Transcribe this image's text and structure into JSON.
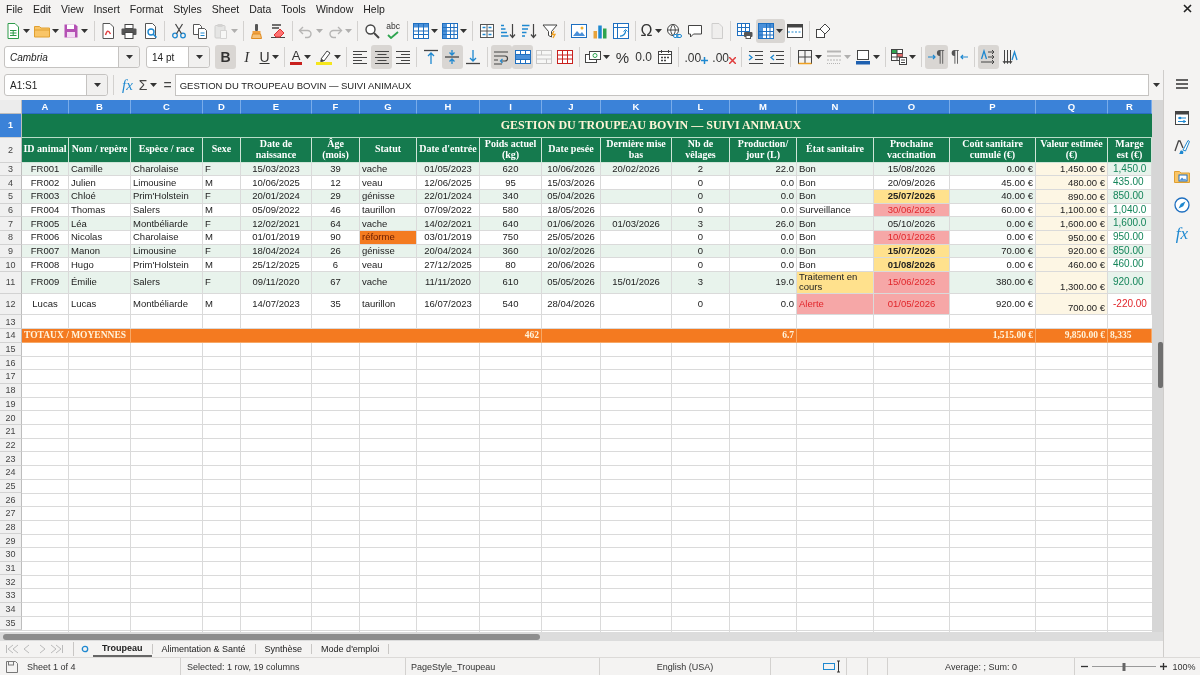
{
  "menu_bar": [
    "File",
    "Edit",
    "View",
    "Insert",
    "Format",
    "Styles",
    "Sheet",
    "Data",
    "Tools",
    "Window",
    "Help"
  ],
  "standard_toolbar": [
    [
      {
        "kind": "new",
        "on": false,
        "disabled": false
      },
      {
        "kind": "open",
        "on": false,
        "disabled": false
      },
      {
        "kind": "save",
        "on": false,
        "disabled": false
      }
    ],
    [
      {
        "kind": "export-pdf",
        "on": false,
        "disabled": false
      },
      {
        "kind": "print",
        "on": false,
        "disabled": false
      },
      {
        "kind": "print-preview",
        "on": false,
        "disabled": false
      }
    ],
    [
      {
        "kind": "cut",
        "on": false,
        "disabled": false
      },
      {
        "kind": "copy",
        "on": false,
        "disabled": false
      },
      {
        "kind": "paste",
        "on": false,
        "disabled": true
      }
    ],
    [
      {
        "kind": "clone-formatting",
        "on": false,
        "disabled": false
      },
      {
        "kind": "clear-formatting",
        "on": false,
        "disabled": false
      }
    ],
    [
      {
        "kind": "undo",
        "on": false,
        "disabled": true
      },
      {
        "kind": "redo",
        "on": false,
        "disabled": true
      }
    ],
    [
      {
        "kind": "find-replace",
        "on": false,
        "disabled": false
      },
      {
        "kind": "spelling",
        "label": "abc",
        "on": false,
        "disabled": false
      }
    ],
    [
      {
        "kind": "rows",
        "on": false,
        "disabled": false
      },
      {
        "kind": "columns",
        "on": false,
        "disabled": false
      }
    ],
    [
      {
        "kind": "sort",
        "on": false,
        "disabled": false
      },
      {
        "kind": "sort-ascending",
        "on": false,
        "disabled": false
      },
      {
        "kind": "sort-descending",
        "on": false,
        "disabled": false
      },
      {
        "kind": "autofilter",
        "on": false,
        "disabled": false
      }
    ],
    [
      {
        "kind": "image",
        "on": false,
        "disabled": false
      },
      {
        "kind": "chart",
        "on": false,
        "disabled": false
      },
      {
        "kind": "pivot-table",
        "on": false,
        "disabled": false
      }
    ],
    [
      {
        "kind": "special-character",
        "label": "Ω",
        "on": false,
        "disabled": false
      },
      {
        "kind": "hyperlink",
        "on": false,
        "disabled": false
      },
      {
        "kind": "comment",
        "on": false,
        "disabled": false
      },
      {
        "kind": "header-footer",
        "on": false,
        "disabled": true
      }
    ],
    [
      {
        "kind": "print-area",
        "on": false,
        "disabled": false
      },
      {
        "kind": "freeze",
        "on": true,
        "disabled": false
      },
      {
        "kind": "split-window",
        "on": false,
        "disabled": false
      }
    ],
    [
      {
        "kind": "shapes",
        "on": false,
        "disabled": false
      }
    ]
  ],
  "formatting_toolbar": {
    "font_name": "Cambria",
    "font_size": "14 pt",
    "groups": [
      [
        {
          "kind": "bold",
          "label": "B",
          "on": true,
          "disabled": false
        },
        {
          "kind": "italic",
          "label": "I",
          "on": false,
          "disabled": false
        },
        {
          "kind": "underline",
          "label": "U",
          "on": false,
          "disabled": false
        }
      ],
      [
        {
          "kind": "font-color",
          "label": "A",
          "on": false,
          "disabled": false
        },
        {
          "kind": "highlight",
          "on": false,
          "disabled": false
        }
      ],
      [
        {
          "kind": "align-left",
          "on": false,
          "disabled": false
        },
        {
          "kind": "align-center",
          "on": true,
          "disabled": false
        },
        {
          "kind": "align-right",
          "on": false,
          "disabled": false
        }
      ],
      [
        {
          "kind": "align-top",
          "on": false,
          "disabled": false
        },
        {
          "kind": "align-middle",
          "on": true,
          "disabled": false
        },
        {
          "kind": "align-bottom",
          "on": false,
          "disabled": false
        }
      ],
      [
        {
          "kind": "wrap-text",
          "on": true,
          "disabled": false
        },
        {
          "kind": "merge-center",
          "on": true,
          "disabled": false
        },
        {
          "kind": "merge-cells",
          "on": false,
          "disabled": true
        },
        {
          "kind": "unmerge-cells",
          "on": false,
          "disabled": false
        }
      ],
      [
        {
          "kind": "currency",
          "on": false,
          "disabled": false
        },
        {
          "kind": "percent",
          "label": "%",
          "on": false,
          "disabled": false
        },
        {
          "kind": "number",
          "label": "0.0",
          "on": false,
          "disabled": false
        },
        {
          "kind": "date",
          "on": false,
          "disabled": false
        }
      ],
      [
        {
          "kind": "add-decimal",
          "label": ".00",
          "on": false,
          "disabled": false
        },
        {
          "kind": "delete-decimal",
          "label": ".00",
          "on": false,
          "disabled": false
        }
      ],
      [
        {
          "kind": "indent-increase",
          "on": false,
          "disabled": false
        },
        {
          "kind": "indent-decrease",
          "on": false,
          "disabled": false
        }
      ],
      [
        {
          "kind": "borders",
          "on": false,
          "disabled": false
        },
        {
          "kind": "border-style",
          "on": false,
          "disabled": true
        },
        {
          "kind": "border-color",
          "on": false,
          "disabled": false
        }
      ],
      [
        {
          "kind": "conditional",
          "on": false,
          "disabled": false
        }
      ],
      [
        {
          "kind": "left-to-right",
          "label": "¶",
          "on": true,
          "disabled": false
        },
        {
          "kind": "right-to-left",
          "label": "¶",
          "on": false,
          "disabled": false
        }
      ],
      [
        {
          "kind": "text-horizontal",
          "on": true,
          "disabled": false
        },
        {
          "kind": "text-vertical",
          "on": false,
          "disabled": false
        }
      ]
    ]
  },
  "formula_bar": {
    "name_box": "A1:S1",
    "function_wizard": "fx",
    "sum": "Σ",
    "formula": "=",
    "content": "GESTION DU TROUPEAU BOVIN — SUIVI ANIMAUX"
  },
  "sheet": {
    "columns": [
      {
        "label": "A",
        "selected": true
      },
      {
        "label": "B",
        "selected": true
      },
      {
        "label": "C",
        "selected": true
      },
      {
        "label": "D",
        "selected": true
      },
      {
        "label": "E",
        "selected": true
      },
      {
        "label": "F",
        "selected": true
      },
      {
        "label": "G",
        "selected": true
      },
      {
        "label": "H",
        "selected": true
      },
      {
        "label": "I",
        "selected": true
      },
      {
        "label": "J",
        "selected": true
      },
      {
        "label": "K",
        "selected": true
      },
      {
        "label": "L",
        "selected": true
      },
      {
        "label": "M",
        "selected": true
      },
      {
        "label": "N",
        "selected": true
      },
      {
        "label": "O",
        "selected": true
      },
      {
        "label": "P",
        "selected": true
      },
      {
        "label": "Q",
        "selected": true
      },
      {
        "label": "R",
        "selected": true
      }
    ],
    "title_row": {
      "row": "1",
      "selected": true,
      "text": "GESTION DU TROUPEAU BOVIN — SUIVI ANIMAUX"
    },
    "header_row": {
      "row": "2",
      "selected": false,
      "cells": [
        "ID animal",
        "Nom / repère",
        "Espèce / race",
        "Sexe",
        "Date de naissance",
        "Âge (mois)",
        "Statut",
        "Date d'entrée",
        "Poids actuel (kg)",
        "Date pesée",
        "Dernière mise bas",
        "Nb de vêlages",
        "Production/ jour (L)",
        "État sanitaire",
        "Prochaine vaccination",
        "Coût sanitaire cumulé (€)",
        "Valeur estimée (€)",
        "Marge est (€)"
      ]
    },
    "data_rows": [
      {
        "row": "3",
        "selected": false,
        "cells": [
          "FR001",
          "Camille",
          "Charolaise",
          "F",
          "15/03/2023",
          "39",
          "vache",
          "01/05/2023",
          "620",
          "10/06/2026",
          "20/02/2026",
          "2",
          "22.0",
          "Bon",
          "15/08/2026",
          "0.00 €",
          "1,450.00 €",
          "1,450.0"
        ],
        "status_highlighted": false,
        "health_warning": false,
        "health_alert": false,
        "vaccination_warning": false,
        "vaccination_alert": false,
        "loss": false
      },
      {
        "row": "4",
        "selected": false,
        "cells": [
          "FR002",
          "Julien",
          "Limousine",
          "M",
          "10/06/2025",
          "12",
          "veau",
          "12/06/2025",
          "95",
          "15/03/2026",
          null,
          "0",
          "0.0",
          "Bon",
          "20/09/2026",
          "45.00 €",
          "480.00 €",
          "435.00"
        ],
        "status_highlighted": false,
        "health_warning": false,
        "health_alert": false,
        "vaccination_warning": false,
        "vaccination_alert": false,
        "loss": false
      },
      {
        "row": "5",
        "selected": false,
        "cells": [
          "FR003",
          "Chloé",
          "Prim'Holstein",
          "F",
          "20/01/2024",
          "29",
          "génisse",
          "22/01/2024",
          "340",
          "05/04/2026",
          null,
          "0",
          "0.0",
          "Bon",
          "25/07/2026",
          "40.00 €",
          "890.00 €",
          "850.00"
        ],
        "status_highlighted": false,
        "health_warning": false,
        "health_alert": false,
        "vaccination_warning": true,
        "vaccination_alert": false,
        "loss": false
      },
      {
        "row": "6",
        "selected": false,
        "cells": [
          "FR004",
          "Thomas",
          "Salers",
          "M",
          "05/09/2022",
          "46",
          "taurillon",
          "07/09/2022",
          "580",
          "18/05/2026",
          null,
          "0",
          "0.0",
          "Surveillance",
          "30/06/2026",
          "60.00 €",
          "1,100.00 €",
          "1,040.0"
        ],
        "status_highlighted": false,
        "health_warning": false,
        "health_alert": false,
        "vaccination_warning": false,
        "vaccination_alert": true,
        "loss": false
      },
      {
        "row": "7",
        "selected": false,
        "cells": [
          "FR005",
          "Léa",
          "Montbéliarde",
          "F",
          "12/02/2021",
          "64",
          "vache",
          "14/02/2021",
          "640",
          "01/06/2026",
          "01/03/2026",
          "3",
          "26.0",
          "Bon",
          "05/10/2026",
          "0.00 €",
          "1,600.00 €",
          "1,600.0"
        ],
        "status_highlighted": false,
        "health_warning": false,
        "health_alert": false,
        "vaccination_warning": false,
        "vaccination_alert": false,
        "loss": false
      },
      {
        "row": "8",
        "selected": false,
        "cells": [
          "FR006",
          "Nicolas",
          "Charolaise",
          "M",
          "01/01/2019",
          "90",
          "réforme",
          "03/01/2019",
          "750",
          "25/05/2026",
          null,
          "0",
          "0.0",
          "Bon",
          "10/01/2026",
          "0.00 €",
          "950.00 €",
          "950.00"
        ],
        "status_highlighted": true,
        "health_warning": false,
        "health_alert": false,
        "vaccination_warning": false,
        "vaccination_alert": true,
        "loss": false
      },
      {
        "row": "9",
        "selected": false,
        "cells": [
          "FR007",
          "Manon",
          "Limousine",
          "F",
          "18/04/2024",
          "26",
          "génisse",
          "20/04/2024",
          "360",
          "10/02/2026",
          null,
          "0",
          "0.0",
          "Bon",
          "15/07/2026",
          "70.00 €",
          "920.00 €",
          "850.00"
        ],
        "status_highlighted": false,
        "health_warning": false,
        "health_alert": false,
        "vaccination_warning": true,
        "vaccination_alert": false,
        "loss": false
      },
      {
        "row": "10",
        "selected": false,
        "cells": [
          "FR008",
          "Hugo",
          "Prim'Holstein",
          "M",
          "25/12/2025",
          "6",
          "veau",
          "27/12/2025",
          "80",
          "20/06/2026",
          null,
          "0",
          "0.0",
          "Bon",
          "01/08/2026",
          "0.00 €",
          "460.00 €",
          "460.00"
        ],
        "status_highlighted": false,
        "health_warning": false,
        "health_alert": false,
        "vaccination_warning": true,
        "vaccination_alert": false,
        "loss": false
      },
      {
        "row": "11",
        "selected": false,
        "cells": [
          "FR009",
          "Émilie",
          "Salers",
          "F",
          "09/11/2020",
          "67",
          "vache",
          "11/11/2020",
          "610",
          "05/05/2026",
          "15/01/2026",
          "3",
          "19.0",
          "Traitement en cours",
          "15/06/2026",
          "380.00 €",
          "1,300.00 €",
          "920.00"
        ],
        "status_highlighted": false,
        "health_warning": true,
        "health_alert": false,
        "vaccination_warning": false,
        "vaccination_alert": true,
        "loss": false
      },
      {
        "row": "12",
        "selected": false,
        "cells": [
          "Lucas",
          "Lucas",
          "Montbéliarde",
          "M",
          "14/07/2023",
          "35",
          "taurillon",
          "16/07/2023",
          "540",
          "28/04/2026",
          null,
          "0",
          "0.0",
          "Alerte",
          "01/05/2026",
          "920.00 €",
          "700.00 €",
          "-220.00"
        ],
        "status_highlighted": false,
        "health_warning": false,
        "health_alert": true,
        "vaccination_warning": false,
        "vaccination_alert": true,
        "loss": true
      }
    ],
    "spacer_rows": [
      {
        "row": "13",
        "selected": false
      }
    ],
    "totals_row": {
      "row": "14",
      "selected": false,
      "cells": [
        "TOTAUX / MOYENNES",
        null,
        null,
        null,
        null,
        null,
        null,
        null,
        "462",
        null,
        null,
        null,
        "6.7",
        null,
        null,
        "1,515.00 €",
        "9,850.00 €",
        "8,335"
      ]
    },
    "empty_rows": [
      {
        "row": "15",
        "selected": false
      },
      {
        "row": "16",
        "selected": false
      },
      {
        "row": "17",
        "selected": false
      },
      {
        "row": "18",
        "selected": false
      },
      {
        "row": "19",
        "selected": false
      },
      {
        "row": "20",
        "selected": false
      },
      {
        "row": "21",
        "selected": false
      },
      {
        "row": "22",
        "selected": false
      },
      {
        "row": "23",
        "selected": false
      },
      {
        "row": "24",
        "selected": false
      },
      {
        "row": "25",
        "selected": false
      },
      {
        "row": "26",
        "selected": false
      },
      {
        "row": "27",
        "selected": false
      },
      {
        "row": "28",
        "selected": false
      },
      {
        "row": "29",
        "selected": false
      },
      {
        "row": "30",
        "selected": false
      },
      {
        "row": "31",
        "selected": false
      },
      {
        "row": "32",
        "selected": false
      },
      {
        "row": "33",
        "selected": false
      },
      {
        "row": "34",
        "selected": false
      },
      {
        "row": "35",
        "selected": false
      }
    ]
  },
  "sidebar": {
    "tabs": [
      {
        "kind": "properties",
        "selected": false
      },
      {
        "kind": "styles",
        "selected": false
      },
      {
        "kind": "gallery",
        "selected": false
      },
      {
        "kind": "navigator",
        "selected": false
      },
      {
        "kind": "functions",
        "label": "fx",
        "selected": false
      }
    ]
  },
  "sheet_navigation": [
    {
      "kind": "first",
      "disabled": true
    },
    {
      "kind": "previous",
      "disabled": true
    },
    {
      "kind": "next",
      "disabled": true
    },
    {
      "kind": "last",
      "disabled": true
    }
  ],
  "sheet_tabs": [
    {
      "label": "Troupeau",
      "selected": true
    },
    {
      "label": "Alimentation & Santé",
      "selected": false
    },
    {
      "label": "Synthèse",
      "selected": false
    },
    {
      "label": "Mode d'emploi",
      "selected": false
    }
  ],
  "status_bar": {
    "sheet": "Sheet 1 of 4",
    "selection": "Selected: 1 row, 19 columns",
    "page_style": "PageStyle_Troupeau",
    "language": "English (USA)",
    "statistics": "Average: ; Sum: 0",
    "zoom_slider": {
      "level": 0.5
    },
    "zoom": "100%"
  }
}
